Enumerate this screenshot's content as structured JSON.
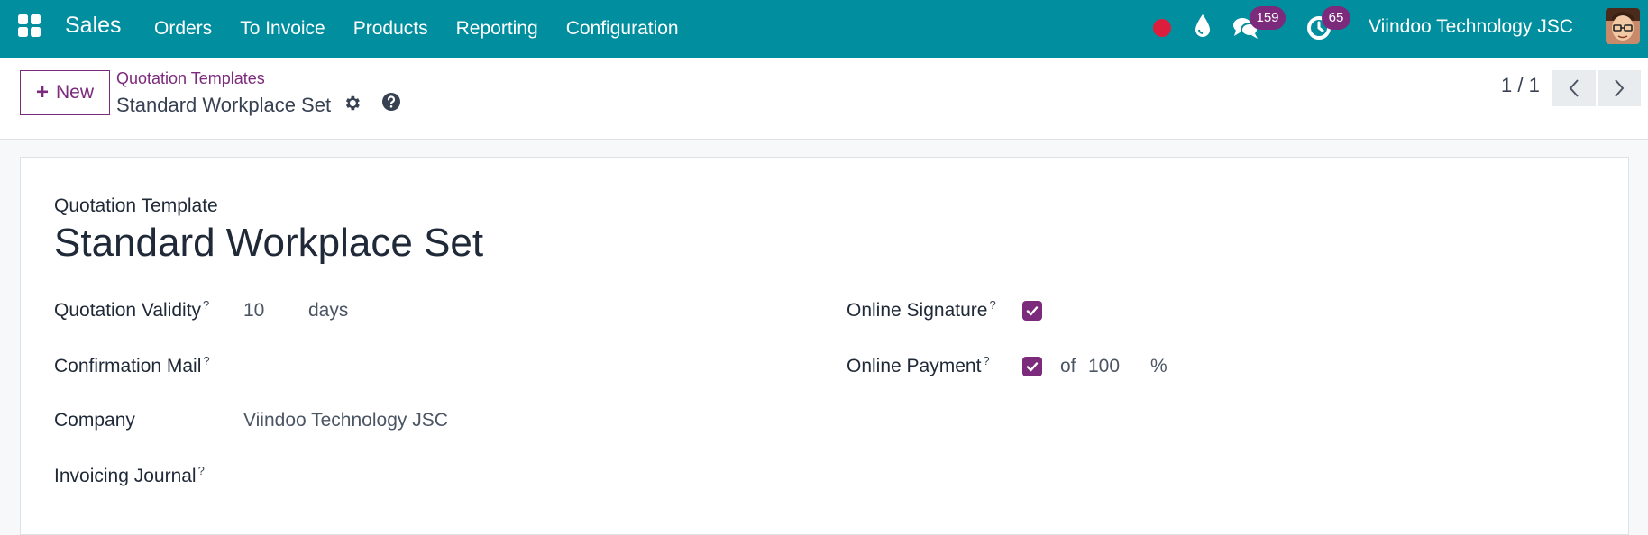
{
  "navbar": {
    "brand": "Sales",
    "menu": [
      "Orders",
      "To Invoice",
      "Products",
      "Reporting",
      "Configuration"
    ],
    "chat_count": "159",
    "activity_count": "65",
    "company": "Viindoo Technology JSC",
    "colors": {
      "bar": "#018e9e",
      "badge": "#7c2a7c",
      "record": "#dc1e3c"
    },
    "icons": [
      "apps-icon",
      "record-icon",
      "drop-icon",
      "chat-icon",
      "clock-icon",
      "avatar"
    ]
  },
  "control_panel": {
    "new_label": "New",
    "breadcrumb_parent": "Quotation Templates",
    "current_title": "Standard Workplace Set",
    "pager": "1 / 1"
  },
  "form": {
    "section_label": "Quotation Template",
    "title": "Standard Workplace Set",
    "fields": {
      "validity_label": "Quotation Validity",
      "validity_value": "10",
      "validity_unit": "days",
      "confirmation_label": "Confirmation Mail",
      "company_label": "Company",
      "company_value": "Viindoo Technology JSC",
      "journal_label": "Invoicing Journal",
      "signature_label": "Online Signature",
      "payment_label": "Online Payment",
      "payment_prefix": "of",
      "payment_value": "100",
      "payment_unit": "%"
    },
    "help_mark": "?",
    "online_signature_checked": true,
    "online_payment_checked": true
  }
}
